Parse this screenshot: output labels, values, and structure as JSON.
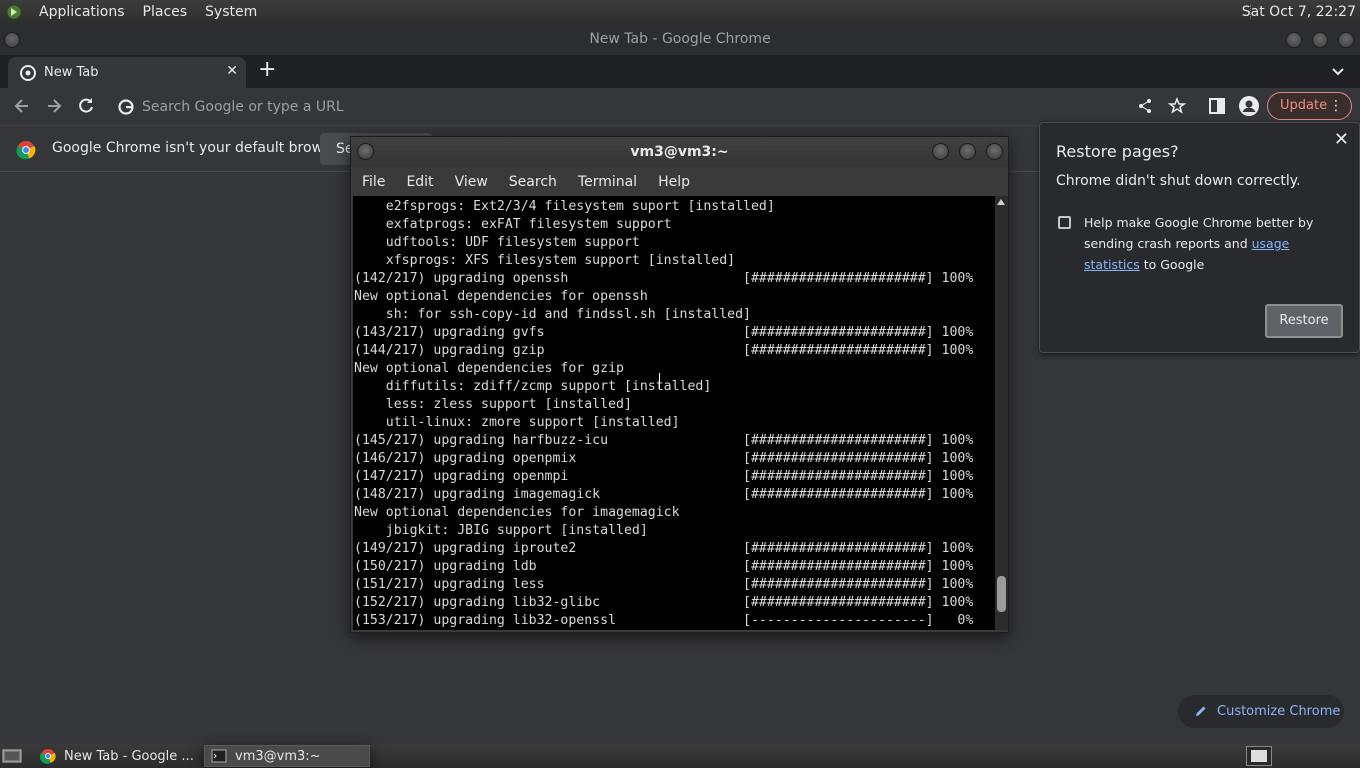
{
  "top_panel": {
    "menus": [
      "Applications",
      "Places",
      "System"
    ],
    "clock": "Sat Oct  7, 22:27"
  },
  "chrome": {
    "window_title": "New Tab - Google Chrome",
    "tab_title": "New Tab",
    "omnibox_placeholder": "Search Google or type a URL",
    "update_label": "Update",
    "infobar_text": "Google Chrome isn't your default browser",
    "infobar_button": "Se",
    "customize_label": "Customize Chrome"
  },
  "restore": {
    "title": "Restore pages?",
    "subtitle": "Chrome didn't shut down correctly.",
    "desc_part1": "Help make Google Chrome better by sending crash reports and ",
    "desc_link": "usage statistics",
    "desc_part2": " to Google",
    "button": "Restore"
  },
  "terminal": {
    "title": "vm3@vm3:~",
    "menu": [
      "File",
      "Edit",
      "View",
      "Search",
      "Terminal",
      "Help"
    ],
    "lines": [
      "    e2fsprogs: Ext2/3/4 filesystem suport [installed]",
      "    exfatprogs: exFAT filesystem support",
      "    udftools: UDF filesystem support",
      "    xfsprogs: XFS filesystem support [installed]",
      "(142/217) upgrading openssh                      [######################] 100%",
      "New optional dependencies for openssh",
      "    sh: for ssh-copy-id and findssl.sh [installed]",
      "(143/217) upgrading gvfs                         [######################] 100%",
      "(144/217) upgrading gzip                         [######################] 100%",
      "New optional dependencies for gzip",
      "    diffutils: zdiff/zcmp support [installed]",
      "    less: zless support [installed]",
      "    util-linux: zmore support [installed]",
      "(145/217) upgrading harfbuzz-icu                 [######################] 100%",
      "(146/217) upgrading openpmix                     [######################] 100%",
      "(147/217) upgrading openmpi                      [######################] 100%",
      "(148/217) upgrading imagemagick                  [######################] 100%",
      "New optional dependencies for imagemagick",
      "    jbigkit: JBIG support [installed]",
      "(149/217) upgrading iproute2                     [######################] 100%",
      "(150/217) upgrading ldb                          [######################] 100%",
      "(151/217) upgrading less                         [######################] 100%",
      "(152/217) upgrading lib32-glibc                  [######################] 100%",
      "(153/217) upgrading lib32-openssl                [----------------------]   0%"
    ]
  },
  "taskbar": {
    "tasks": [
      "New Tab - Google ...",
      "vm3@vm3:~"
    ]
  },
  "colors": {
    "accent_link": "#8ab4f8",
    "update_text": "#f28b82",
    "terminal_bg": "#000000"
  }
}
